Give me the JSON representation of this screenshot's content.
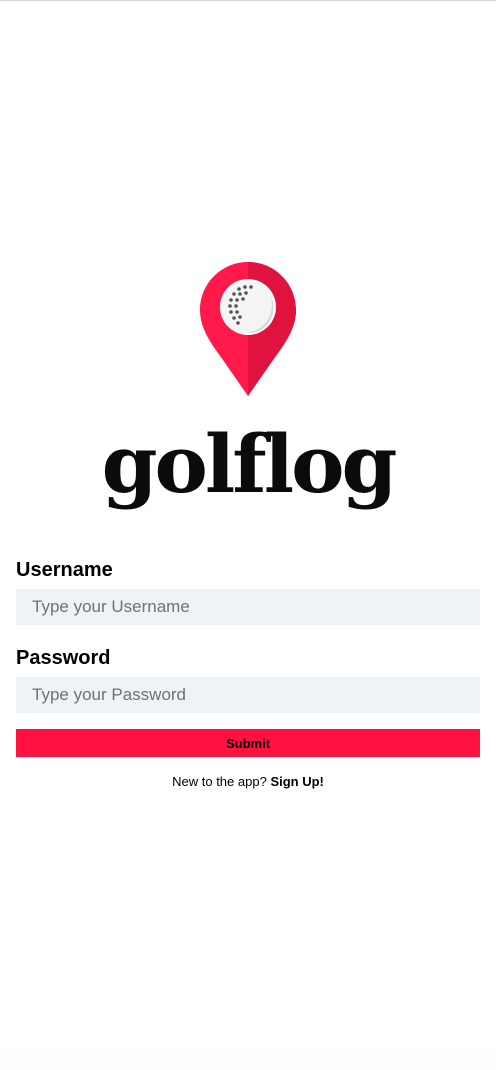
{
  "brand": {
    "name": "golflog",
    "logo_icon": "map-pin-golf-ball-icon",
    "accent_color": "#ff1142"
  },
  "form": {
    "username_label": "Username",
    "username_placeholder": "Type your Username",
    "username_value": "",
    "password_label": "Password",
    "password_placeholder": "Type your Password",
    "password_value": "",
    "submit_label": "Submit"
  },
  "signup": {
    "prompt": "New to the app?",
    "link_label": "Sign Up!"
  }
}
